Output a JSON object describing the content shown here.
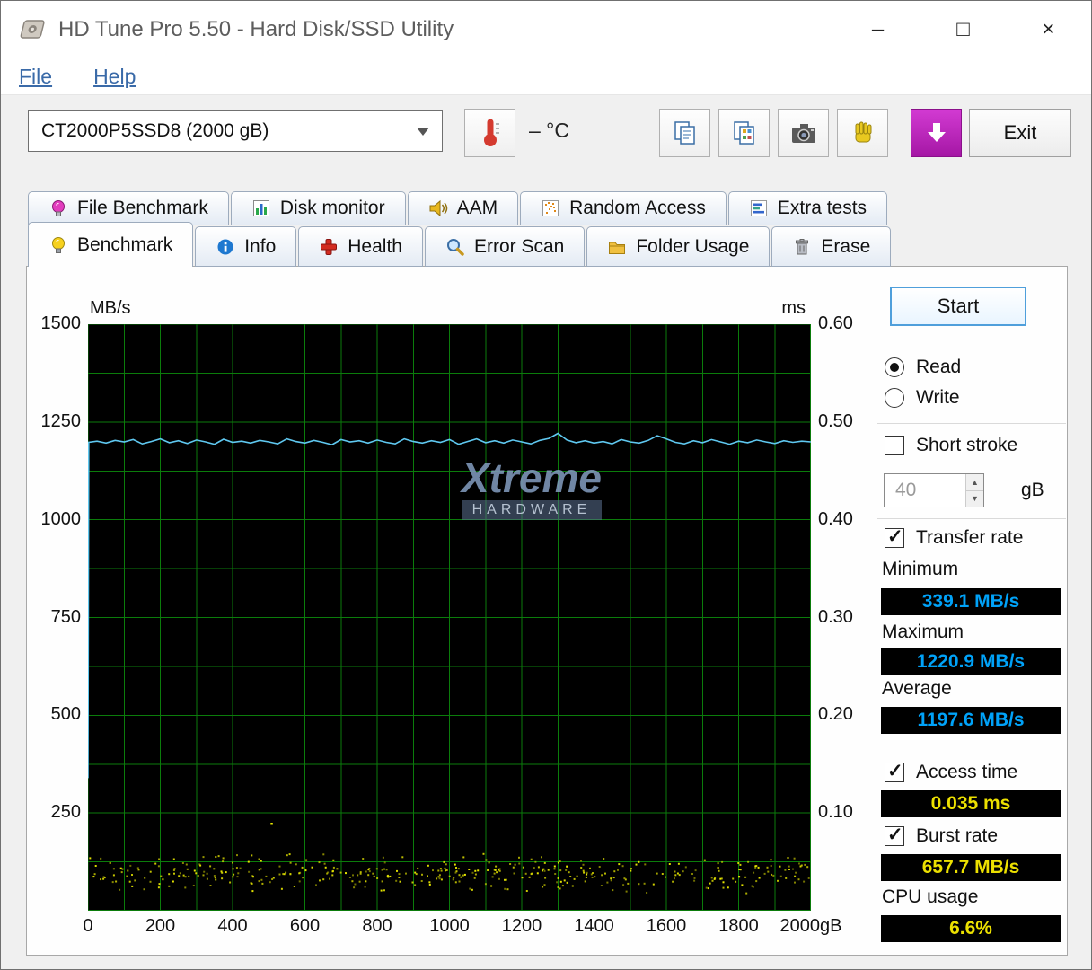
{
  "window": {
    "title": "HD Tune Pro 5.50 - Hard Disk/SSD Utility",
    "controls": {
      "minimize": "–",
      "maximize": "□",
      "close": "×"
    }
  },
  "menu": {
    "items": [
      {
        "label": "File"
      },
      {
        "label": "Help"
      }
    ]
  },
  "toolbar": {
    "drive_select": {
      "value": "CT2000P5SSD8 (2000 gB)"
    },
    "temperature": "– °C",
    "buttons": [
      {
        "name": "copy",
        "icon": "copy"
      },
      {
        "name": "copy-image",
        "icon": "copy-image"
      },
      {
        "name": "screenshot",
        "icon": "camera"
      },
      {
        "name": "donate",
        "icon": "hand"
      },
      {
        "name": "save-results",
        "icon": "download",
        "style": "magenta"
      }
    ],
    "exit_label": "Exit"
  },
  "tabs": {
    "row1": [
      {
        "label": "File Benchmark",
        "icon": "file-benchmark"
      },
      {
        "label": "Disk monitor",
        "icon": "disk-monitor"
      },
      {
        "label": "AAM",
        "icon": "aam"
      },
      {
        "label": "Random Access",
        "icon": "random-access"
      },
      {
        "label": "Extra tests",
        "icon": "extra-tests"
      }
    ],
    "row2": [
      {
        "label": "Benchmark",
        "icon": "benchmark",
        "active": true
      },
      {
        "label": "Info",
        "icon": "info"
      },
      {
        "label": "Health",
        "icon": "health"
      },
      {
        "label": "Error Scan",
        "icon": "error-scan"
      },
      {
        "label": "Folder Usage",
        "icon": "folder-usage"
      },
      {
        "label": "Erase",
        "icon": "erase"
      }
    ]
  },
  "chart_data": {
    "type": "line",
    "left_axis": {
      "label": "MB/s",
      "min": 0,
      "max": 1500,
      "ticks": [
        1500,
        1250,
        1000,
        750,
        500,
        250
      ]
    },
    "right_axis": {
      "label": "ms",
      "min": 0,
      "max": 0.6,
      "ticks": [
        {
          "v": 0.6,
          "label": "0.60"
        },
        {
          "v": 0.5,
          "label": "0.50"
        },
        {
          "v": 0.4,
          "label": "0.40"
        },
        {
          "v": 0.3,
          "label": "0.30"
        },
        {
          "v": 0.2,
          "label": "0.20"
        },
        {
          "v": 0.1,
          "label": "0.10"
        }
      ]
    },
    "x_axis": {
      "min": 0,
      "max": 2000,
      "ticks": [
        {
          "v": 0,
          "label": "0"
        },
        {
          "v": 200,
          "label": "200"
        },
        {
          "v": 400,
          "label": "400"
        },
        {
          "v": 600,
          "label": "600"
        },
        {
          "v": 800,
          "label": "800"
        },
        {
          "v": 1000,
          "label": "1000"
        },
        {
          "v": 1200,
          "label": "1200"
        },
        {
          "v": 1400,
          "label": "1400"
        },
        {
          "v": 1600,
          "label": "1600"
        },
        {
          "v": 1800,
          "label": "1800"
        },
        {
          "v": 2000,
          "label": "2000gB"
        }
      ]
    },
    "grid": {
      "x_step": 100,
      "left_step": 125,
      "color": "#0b7c0b",
      "background": "#000000"
    },
    "series": [
      {
        "name": "transfer-rate",
        "axis": "left",
        "unit": "MB/s",
        "color": "#5fc8f0",
        "x": [
          0,
          2,
          25,
          50,
          75,
          100,
          125,
          150,
          175,
          200,
          225,
          250,
          275,
          300,
          325,
          350,
          375,
          400,
          425,
          450,
          475,
          500,
          525,
          550,
          575,
          600,
          625,
          650,
          675,
          700,
          725,
          750,
          775,
          800,
          825,
          850,
          875,
          900,
          925,
          950,
          975,
          1000,
          1025,
          1050,
          1075,
          1100,
          1125,
          1150,
          1175,
          1200,
          1225,
          1250,
          1275,
          1300,
          1325,
          1350,
          1375,
          1400,
          1425,
          1450,
          1475,
          1500,
          1525,
          1550,
          1575,
          1600,
          1625,
          1650,
          1675,
          1700,
          1725,
          1750,
          1775,
          1800,
          1825,
          1850,
          1875,
          1900,
          1925,
          1950,
          1975,
          2000
        ],
        "y": [
          339.1,
          1198,
          1201,
          1196,
          1203,
          1199,
          1205,
          1194,
          1200,
          1207,
          1197,
          1202,
          1195,
          1204,
          1199,
          1193,
          1206,
          1198,
          1201,
          1196,
          1203,
          1199,
          1194,
          1207,
          1200,
          1196,
          1203,
          1198,
          1192,
          1205,
          1199,
          1202,
          1196,
          1204,
          1198,
          1194,
          1207,
          1200,
          1196,
          1202,
          1198,
          1205,
          1193,
          1200,
          1207,
          1197,
          1202,
          1196,
          1204,
          1199,
          1194,
          1203,
          1208,
          1220.9,
          1204,
          1197,
          1202,
          1196,
          1200,
          1194,
          1205,
          1199,
          1196,
          1203,
          1215,
          1207,
          1198,
          1194,
          1202,
          1197,
          1205,
          1199,
          1193,
          1201,
          1197,
          1204,
          1199,
          1195,
          1202,
          1198,
          1201,
          1199
        ]
      },
      {
        "name": "access-time-dots",
        "axis": "right",
        "unit": "ms",
        "color": "#e8e800",
        "style": "scatter-band",
        "band_min": 0.018,
        "band_max": 0.06,
        "count": 430,
        "seed": 42,
        "outliers": [
          {
            "x": 505,
            "ms": 0.09
          }
        ]
      }
    ],
    "watermark": {
      "line1": "Xtreme",
      "line2": "HARDWARE"
    }
  },
  "panel": {
    "start_label": "Start",
    "mode": {
      "read": "Read",
      "write": "Write",
      "selected": "Read"
    },
    "short_stroke": {
      "label": "Short stroke",
      "checked": false,
      "value": "40",
      "unit": "gB"
    },
    "transfer_rate": {
      "label": "Transfer rate",
      "checked": true,
      "minimum": {
        "label": "Minimum",
        "value": "339.1 MB/s"
      },
      "maximum": {
        "label": "Maximum",
        "value": "1220.9 MB/s"
      },
      "average": {
        "label": "Average",
        "value": "1197.6 MB/s"
      }
    },
    "access_time": {
      "label": "Access time",
      "checked": true,
      "value": "0.035 ms"
    },
    "burst_rate": {
      "label": "Burst rate",
      "checked": true,
      "value": "657.7 MB/s"
    },
    "cpu_usage": {
      "label": "CPU usage",
      "value": "6.6%"
    }
  },
  "colors": {
    "value_blue": "#00a2f8",
    "value_yellow": "#ece000",
    "grid_green": "#0b7c0b",
    "line_blue": "#5fc8f0",
    "dot_yellow": "#e8e800"
  }
}
